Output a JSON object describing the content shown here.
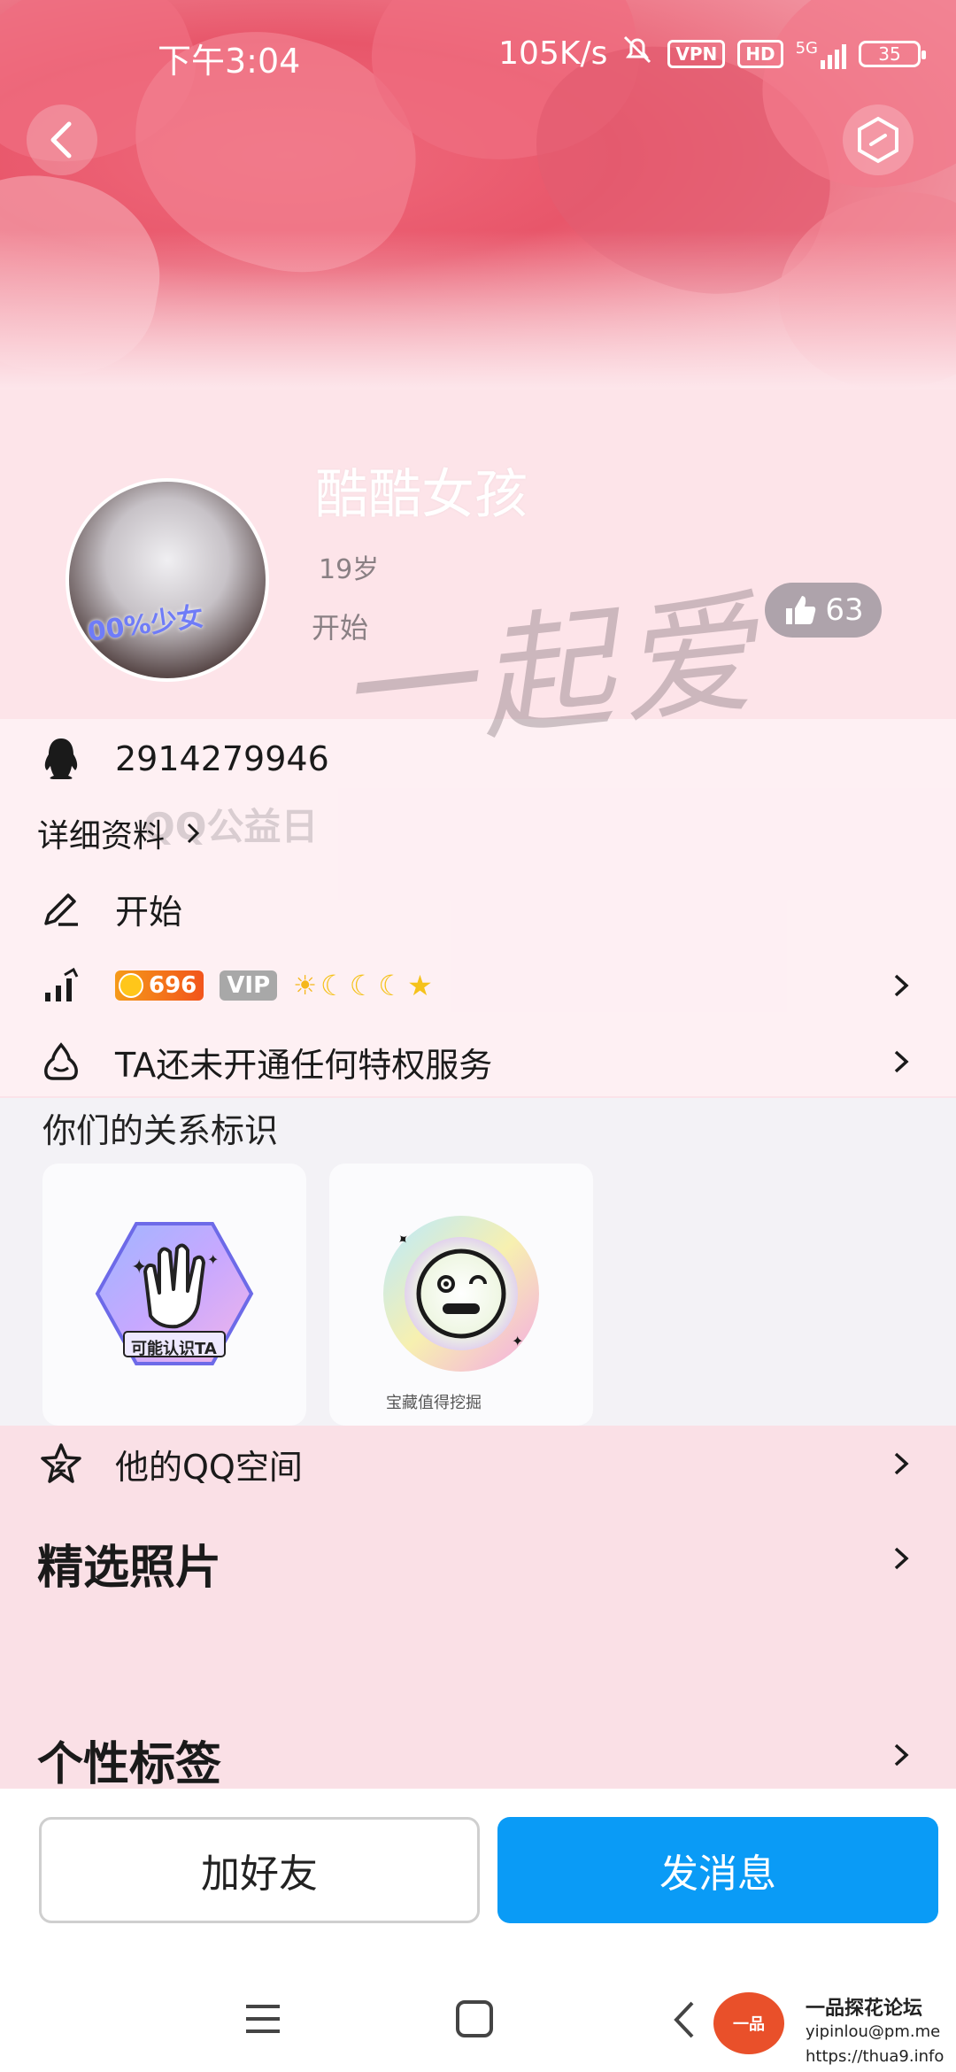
{
  "status_bar": {
    "time": "下午3:04",
    "network_speed": "105K/s",
    "vpn": "VPN",
    "hd": "HD",
    "signal": "5G",
    "battery": "35"
  },
  "profile": {
    "nickname": "酷酷女孩",
    "age": "19岁",
    "signature": "开始",
    "likes": "63",
    "avatar_badge": "00%少女"
  },
  "watermark": {
    "text": "一起爱",
    "caption": "QQ公益日"
  },
  "info": {
    "qq_number": "2914279946",
    "details_link": "详细资料",
    "signature": "开始",
    "level_badge": "696",
    "vip_label": "VIP",
    "privilege_text": "TA还未开通任何特权服务"
  },
  "relationship": {
    "title": "你们的关系标识",
    "cards": [
      {
        "label": "可能认识TA"
      },
      {
        "label": "宝藏值得挖掘"
      }
    ]
  },
  "sections": {
    "qzone": "他的QQ空间",
    "photos": "精选照片",
    "tags": "个性标签"
  },
  "actions": {
    "add_friend": "加好友",
    "send_message": "发消息"
  },
  "forum": {
    "name": "一品探花论坛",
    "email": "yipinlou@pm.me",
    "url": "https://thua9.info"
  },
  "colors": {
    "primary_blue": "#0a9bf6",
    "cover_pink": "#e8566a",
    "level_orange": "#f2541b",
    "vip_gray": "#a8a8a8"
  }
}
